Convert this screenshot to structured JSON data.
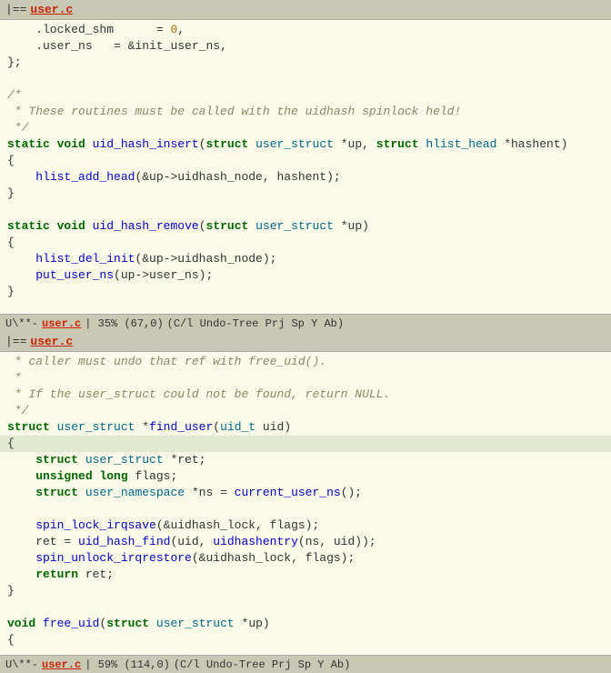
{
  "pane1": {
    "tab_marker": "==",
    "tab_filename": "user.c",
    "status_mode": "U\\**-",
    "status_filename": "user.c",
    "status_pos": "| 35% (67,0)",
    "status_extra": "(C/l Undo-Tree Prj Sp Y Ab)",
    "lines": [
      {
        "text": "    .locked_shm      = 0,",
        "type": "normal"
      },
      {
        "text": "    .user_ns   = &init_user_ns,",
        "type": "normal"
      },
      {
        "text": "};",
        "type": "normal"
      },
      {
        "text": "",
        "type": "normal"
      },
      {
        "text": "/*",
        "type": "comment"
      },
      {
        "text": " * These routines must be called with the uidhash spinlock held!",
        "type": "comment"
      },
      {
        "text": " */",
        "type": "comment"
      },
      {
        "text": "static void uid_hash_insert(struct user_struct *up, struct hlist_head *hashent)",
        "type": "code"
      },
      {
        "text": "{",
        "type": "normal"
      },
      {
        "text": "    hlist_add_head(&up->uidhash_node, hashent);",
        "type": "normal"
      },
      {
        "text": "}",
        "type": "normal"
      },
      {
        "text": "",
        "type": "normal"
      },
      {
        "text": "static void uid_hash_remove(struct user_struct *up)",
        "type": "code"
      },
      {
        "text": "{",
        "type": "normal"
      },
      {
        "text": "    hlist_del_init(&up->uidhash_node);",
        "type": "normal"
      },
      {
        "text": "    put_user_ns(up->user_ns);",
        "type": "normal"
      },
      {
        "text": "}",
        "type": "normal"
      }
    ]
  },
  "pane2": {
    "tab_marker": "==",
    "tab_filename": "user.c",
    "status_mode": "U\\**-",
    "status_filename": "user.c",
    "status_pos": "| 59% (114,0)",
    "status_extra": "(C/l Undo-Tree Prj Sp Y Ab)",
    "lines": [
      {
        "text": " * caller must undo that ref with free_uid().",
        "type": "comment"
      },
      {
        "text": " *",
        "type": "comment"
      },
      {
        "text": " * If the user_struct could not be found, return NULL.",
        "type": "comment"
      },
      {
        "text": " */",
        "type": "comment"
      },
      {
        "text": "struct user_struct *find_user(uid_t uid)",
        "type": "code"
      },
      {
        "text": "{",
        "type": "cursor"
      },
      {
        "text": "    struct user_struct *ret;",
        "type": "normal"
      },
      {
        "text": "    unsigned long flags;",
        "type": "normal"
      },
      {
        "text": "    struct user_namespace *ns = current_user_ns();",
        "type": "normal"
      },
      {
        "text": "",
        "type": "normal"
      },
      {
        "text": "    spin_lock_irqsave(&uidhash_lock, flags);",
        "type": "normal"
      },
      {
        "text": "    ret = uid_hash_find(uid, uidhashentry(ns, uid));",
        "type": "normal"
      },
      {
        "text": "    spin_unlock_irqrestore(&uidhash_lock, flags);",
        "type": "normal"
      },
      {
        "text": "    return ret;",
        "type": "normal"
      },
      {
        "text": "}",
        "type": "normal"
      },
      {
        "text": "",
        "type": "normal"
      },
      {
        "text": "void free_uid(struct user_struct *up)",
        "type": "code"
      },
      {
        "text": "{",
        "type": "normal"
      }
    ]
  }
}
